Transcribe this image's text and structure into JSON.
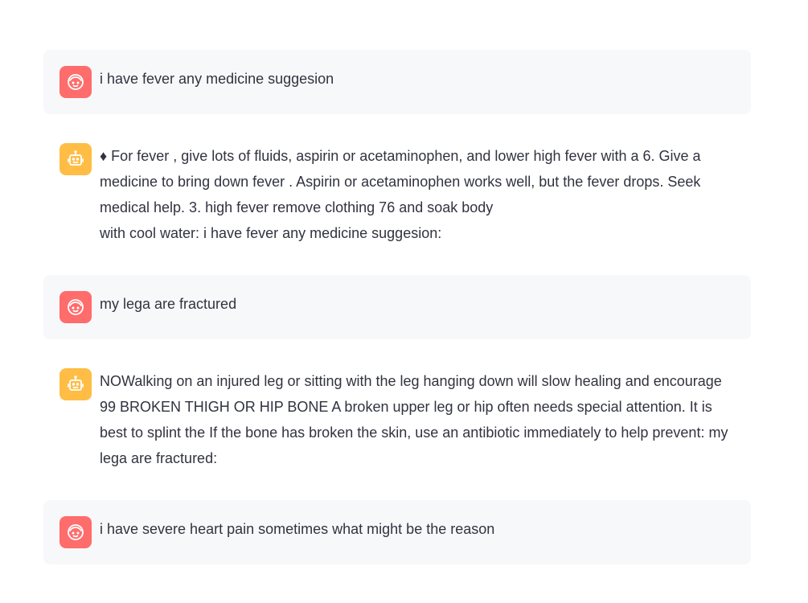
{
  "chat": {
    "messages": [
      {
        "role": "user",
        "avatar_icon": "user-face-icon",
        "text": "i have fever any medicine suggesion"
      },
      {
        "role": "assistant",
        "avatar_icon": "robot-face-icon",
        "text": "♦ For fever , give lots of fluids, aspirin or acetaminophen, and lower high fever with a 6. Give a medicine to bring down fever . Aspirin or acetaminophen works well, but the fever drops. Seek medical help. 3. high fever remove clothing 76 and soak body\nwith cool water: i have fever any medicine suggesion:"
      },
      {
        "role": "user",
        "avatar_icon": "user-face-icon",
        "text": "my lega are fractured"
      },
      {
        "role": "assistant",
        "avatar_icon": "robot-face-icon",
        "text": "NOWalking on an injured leg or sitting with the leg hanging down will slow healing and encourage 99 BROKEN THIGH OR HIP BONE A broken upper leg or hip often needs special attention. It is best to splint the If the bone has broken the skin, use an antibiotic immediately to help prevent: my lega are fractured:"
      },
      {
        "role": "user",
        "avatar_icon": "user-face-icon",
        "text": "i have severe heart pain sometimes what might be the reason"
      }
    ]
  },
  "colors": {
    "user_avatar_bg": "#ff6c6c",
    "assistant_avatar_bg": "#ffbd45",
    "user_message_bg": "#f7f8fa",
    "text": "#31333f"
  }
}
